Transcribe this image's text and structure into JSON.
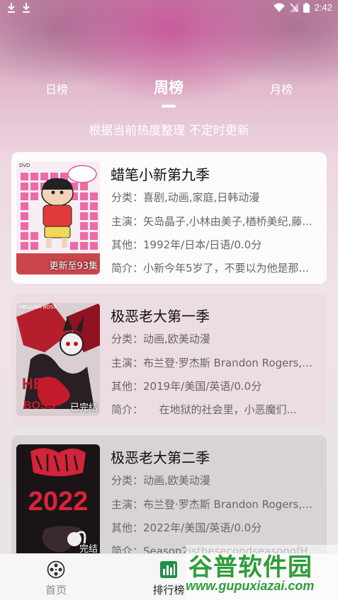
{
  "status_bar": {
    "time": "2:42"
  },
  "tabs": [
    {
      "label": "日榜"
    },
    {
      "label": "周榜"
    },
    {
      "label": "月榜"
    }
  ],
  "active_tab": "周榜",
  "subtitle": "根据当前热度整理 不定时更新",
  "cards": [
    {
      "title": "蜡笔小新第九季",
      "badge": "更新至93集",
      "category": "分类：喜剧,动画,家庭,日韩动漫",
      "cast": "主演：矢岛晶子,小林由美子,楢桥美纪,藤...",
      "other": "其他：1992年/日本/日语/0.0分",
      "intro": "简介：小新今年5岁了，不要以为他是那...",
      "poster_text": "DVD"
    },
    {
      "title": "极恶老大第一季",
      "badge": "已完结",
      "category": "分类：动画,欧美动漫",
      "cast": "主演：布兰登·罗杰斯 Brandon Rogers,理...",
      "other": "其他：2019年/美国/英语/0.0分",
      "intro": "简介：　　在地狱的社会里，小恶魔们...",
      "poster_text": "HELLUVA BOSS"
    },
    {
      "title": "极恶老大第二季",
      "badge": "完结",
      "category": "分类：动画,欧美动漫",
      "cast": "主演：布兰登·罗杰斯 Brandon Rogers,理...",
      "other": "其他：2022年/美国/英语/0.0分",
      "intro": "简介：Season2isthesecondseasonofHel...",
      "poster_text": "2022"
    }
  ],
  "bottom_nav": [
    {
      "label": "首页",
      "icon": "film-reel-icon"
    },
    {
      "label": "排行榜",
      "icon": "ranking-chart-icon"
    }
  ],
  "watermark": {
    "main": "谷普软件园",
    "url": "www.gupuxiazai.com"
  },
  "colors": {
    "accent": "#111111",
    "watermark": "#2f9c3a"
  }
}
